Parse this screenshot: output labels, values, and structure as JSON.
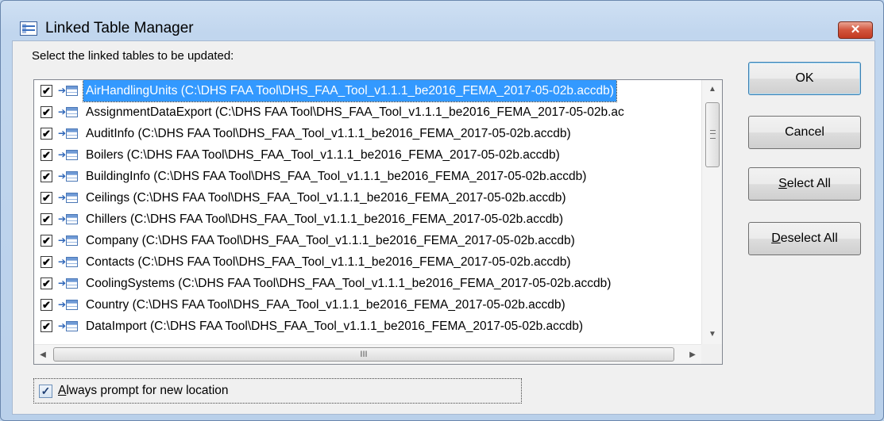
{
  "window": {
    "title": "Linked Table Manager",
    "close_glyph": "✕"
  },
  "prompt": "Select the linked tables to be updated:",
  "tables": [
    {
      "label": "AirHandlingUnits   (C:\\DHS FAA Tool\\DHS_FAA_Tool_v1.1.1_be2016_FEMA_2017-05-02b.accdb)",
      "checked": true,
      "selected": true
    },
    {
      "label": "AssignmentDataExport   (C:\\DHS FAA Tool\\DHS_FAA_Tool_v1.1.1_be2016_FEMA_2017-05-02b.ac",
      "checked": true
    },
    {
      "label": "AuditInfo   (C:\\DHS FAA Tool\\DHS_FAA_Tool_v1.1.1_be2016_FEMA_2017-05-02b.accdb)",
      "checked": true
    },
    {
      "label": "Boilers   (C:\\DHS FAA Tool\\DHS_FAA_Tool_v1.1.1_be2016_FEMA_2017-05-02b.accdb)",
      "checked": true
    },
    {
      "label": "BuildingInfo   (C:\\DHS FAA Tool\\DHS_FAA_Tool_v1.1.1_be2016_FEMA_2017-05-02b.accdb)",
      "checked": true
    },
    {
      "label": "Ceilings   (C:\\DHS FAA Tool\\DHS_FAA_Tool_v1.1.1_be2016_FEMA_2017-05-02b.accdb)",
      "checked": true
    },
    {
      "label": "Chillers   (C:\\DHS FAA Tool\\DHS_FAA_Tool_v1.1.1_be2016_FEMA_2017-05-02b.accdb)",
      "checked": true
    },
    {
      "label": "Company   (C:\\DHS FAA Tool\\DHS_FAA_Tool_v1.1.1_be2016_FEMA_2017-05-02b.accdb)",
      "checked": true
    },
    {
      "label": "Contacts   (C:\\DHS FAA Tool\\DHS_FAA_Tool_v1.1.1_be2016_FEMA_2017-05-02b.accdb)",
      "checked": true
    },
    {
      "label": "CoolingSystems   (C:\\DHS FAA Tool\\DHS_FAA_Tool_v1.1.1_be2016_FEMA_2017-05-02b.accdb)",
      "checked": true
    },
    {
      "label": "Country   (C:\\DHS FAA Tool\\DHS_FAA_Tool_v1.1.1_be2016_FEMA_2017-05-02b.accdb)",
      "checked": true
    },
    {
      "label": "DataImport   (C:\\DHS FAA Tool\\DHS_FAA_Tool_v1.1.1_be2016_FEMA_2017-05-02b.accdb)",
      "checked": true
    }
  ],
  "buttons": {
    "ok": "OK",
    "cancel": "Cancel",
    "select_all": {
      "mnemonic": "S",
      "rest": "elect All"
    },
    "deselect_all": {
      "mnemonic": "D",
      "rest": "eselect All"
    }
  },
  "always_prompt": {
    "label_mnemonic": "A",
    "label_rest": "lways prompt for new location",
    "checked": true
  },
  "scrollbar": {
    "up": "▲",
    "down": "▼",
    "left": "◀",
    "right": "▶",
    "grip": "III"
  }
}
